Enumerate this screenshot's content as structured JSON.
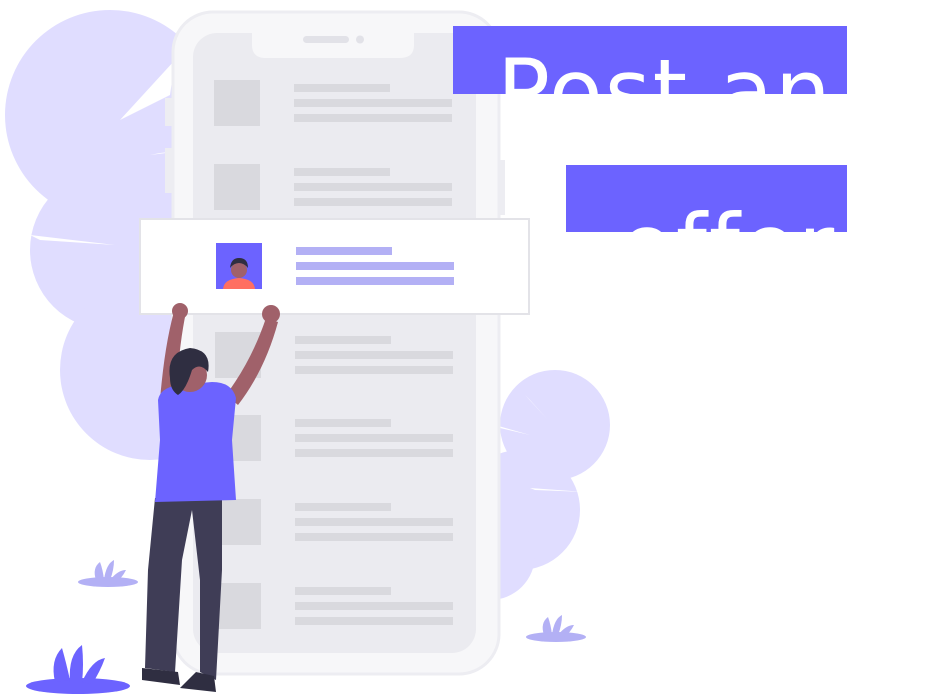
{
  "headline": {
    "line1": "Post an",
    "line2": "offer"
  },
  "colors": {
    "accent": "#6c63ff",
    "blob": "#e0ddff",
    "phone_frame": "#f7f7f9",
    "phone_screen": "#ebebf0",
    "placeholder": "#d9d9de",
    "highlight_line": "#b3b0f5",
    "skin": "#a0616a",
    "hair": "#2f2e41",
    "pants": "#3f3d56",
    "avatar_shirt": "#ff6f61"
  },
  "illustration": {
    "phone_rows": 7,
    "highlighted_row": 2
  }
}
